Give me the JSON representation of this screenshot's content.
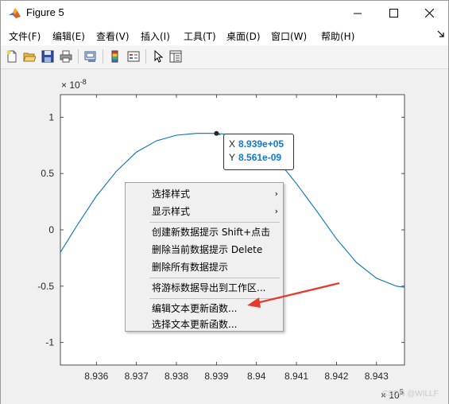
{
  "window": {
    "title": "Figure 5"
  },
  "menubar": {
    "items": [
      "文件(F)",
      "编辑(E)",
      "查看(V)",
      "插入(I)",
      "工具(T)",
      "桌面(D)",
      "窗口(W)",
      "帮助(H)"
    ]
  },
  "toolbar": {
    "icons": [
      "new-figure-icon",
      "open-file-icon",
      "save-icon",
      "print-icon",
      "link-plot-icon",
      "insert-colorbar-icon",
      "insert-legend-icon",
      "pointer-icon",
      "property-editor-icon"
    ]
  },
  "chart_data": {
    "type": "line",
    "title": "",
    "xlabel": "",
    "ylabel": "",
    "x_exponent_label": "× 10^5",
    "y_exponent_label": "× 10^-8",
    "xlim": [
      8.9351,
      8.9437
    ],
    "ylim": [
      -1.2,
      1.2
    ],
    "x_ticks": [
      "8.936",
      "8.937",
      "8.938",
      "8.939",
      "8.94",
      "8.941",
      "8.942",
      "8.943"
    ],
    "y_ticks": [
      "1",
      "0.5",
      "0",
      "-0.5",
      "-1"
    ],
    "grid": false,
    "series": [
      {
        "color": "#0072bd",
        "x": [
          8.9351,
          8.9355,
          8.936,
          8.9365,
          8.937,
          8.9375,
          8.938,
          8.9385,
          8.939,
          8.9395,
          8.94,
          8.9405,
          8.941,
          8.9415,
          8.942,
          8.9425,
          8.943,
          8.9435,
          8.9437
        ],
        "y": [
          -0.2,
          0.03,
          0.3,
          0.52,
          0.69,
          0.79,
          0.84,
          0.856,
          0.856,
          0.84,
          0.77,
          0.63,
          0.41,
          0.17,
          -0.08,
          -0.29,
          -0.43,
          -0.5,
          -0.51
        ]
      }
    ],
    "datatip": {
      "x_key": "X",
      "x_value": "8.939e+05",
      "y_key": "Y",
      "y_value": "8.561e-09",
      "point_x": 8.939,
      "point_y": 0.8561
    }
  },
  "context_menu": {
    "items": [
      {
        "label": "选择样式",
        "submenu": true
      },
      {
        "label": "显示样式",
        "submenu": true
      },
      {
        "label": "创建新数据提示 Shift+点击",
        "submenu": false
      },
      {
        "label": "删除当前数据提示 Delete",
        "submenu": false
      },
      {
        "label": "删除所有数据提示",
        "submenu": false
      },
      {
        "label": "将游标数据导出到工作区...",
        "submenu": false
      },
      {
        "label": "编辑文本更新函数...",
        "submenu": false
      },
      {
        "label": "选择文本更新函数...",
        "submenu": false
      }
    ],
    "arrow_glyph": "›"
  },
  "annotation": {
    "arrow_color": "#e8382b"
  },
  "watermark": "CSDN @WILLF"
}
